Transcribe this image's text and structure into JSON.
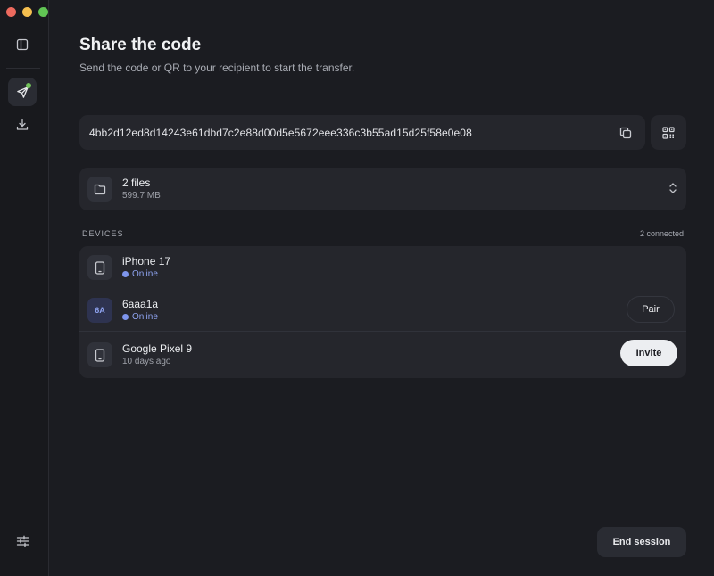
{
  "header": {
    "title": "Share the code",
    "subtitle": "Send the code or QR to your recipient to start the transfer."
  },
  "code": {
    "value": "4bb2d12ed8d14243e61dbd7c2e88d00d5e5672eee336c3b55ad15d25f58e0e08"
  },
  "files": {
    "name": "2 files",
    "size": "599.7 MB"
  },
  "devices": {
    "heading": "DEVICES",
    "count": "2 connected",
    "items": [
      {
        "name": "iPhone 17",
        "status": "Online",
        "icon": "phone-icon"
      },
      {
        "name": "6aaa1a",
        "status": "Online",
        "badge": "6A",
        "action": "Pair"
      },
      {
        "name": "Google Pixel 9",
        "status": "10 days ago",
        "icon": "phone-icon",
        "action": "Invite"
      }
    ]
  },
  "footer": {
    "end_session": "End session"
  },
  "sidebar": {
    "icons": [
      "sidebar-toggle-icon",
      "send-icon",
      "download-icon",
      "settings-sliders-icon"
    ]
  },
  "colors": {
    "online": "#7e95ec",
    "accent_dot": "#72c25a"
  }
}
